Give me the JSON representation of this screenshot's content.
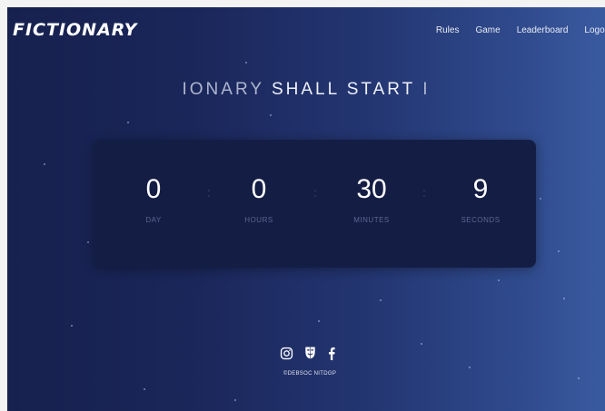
{
  "brand": {
    "logo_text": "FICTIONARY"
  },
  "nav": {
    "rules": "Rules",
    "game": "Game",
    "leaderboard": "Leaderboard",
    "logout": "Logout"
  },
  "headline": {
    "faded": "IONARY ",
    "main": "SHALL START",
    "cursor": " I"
  },
  "countdown": {
    "days": "0",
    "days_label": "DAY",
    "hours": "0",
    "hours_label": "HOURS",
    "minutes": "30",
    "minutes_label": "MINUTES",
    "seconds": "9",
    "seconds_label": "SECONDS"
  },
  "footer": {
    "icons": [
      "instagram-icon",
      "mask-icon",
      "facebook-icon"
    ],
    "copyright": "©DEBSOC NITDGP"
  },
  "colors": {
    "background": "#1a2659",
    "panel": "#141d44",
    "text": "#ffffff",
    "label": "#5b6790"
  }
}
